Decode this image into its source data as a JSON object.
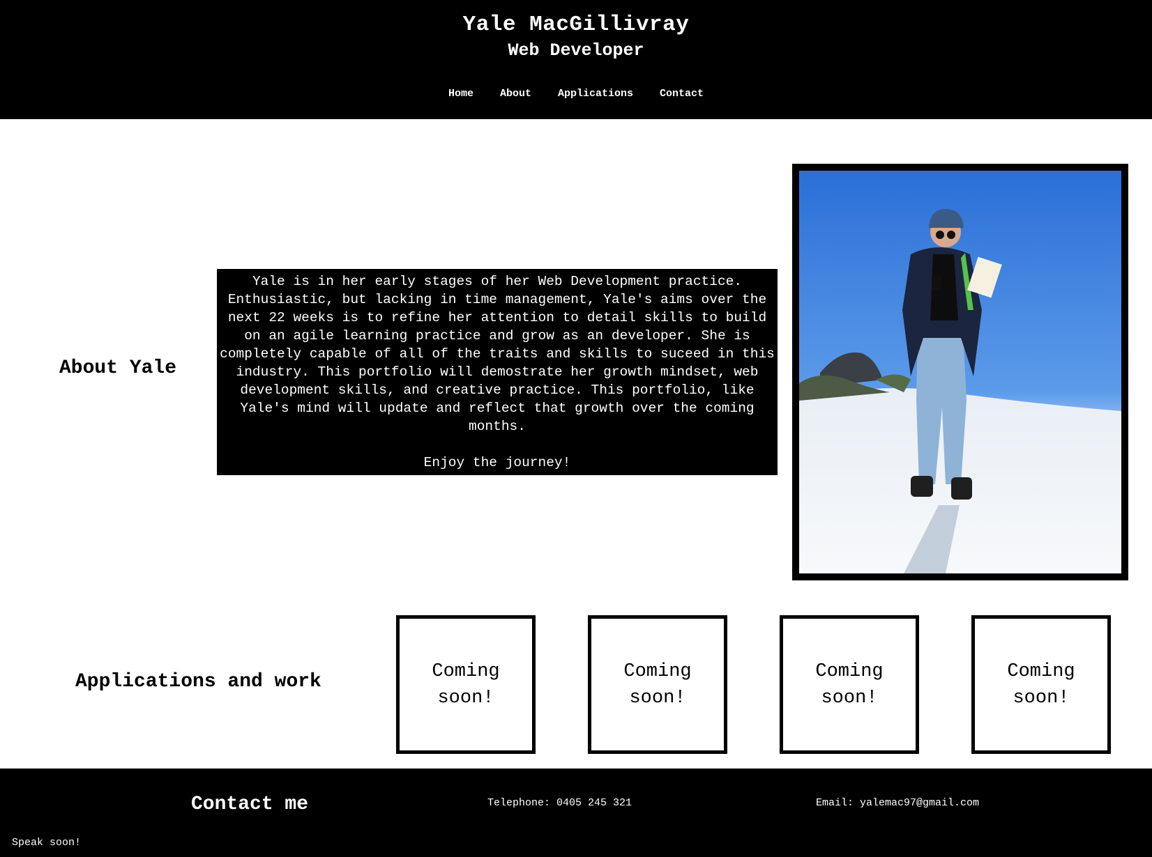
{
  "header": {
    "name": "Yale MacGillivray",
    "role": "Web Developer",
    "nav": [
      {
        "label": "Home"
      },
      {
        "label": "About"
      },
      {
        "label": "Applications"
      },
      {
        "label": "Contact"
      }
    ]
  },
  "about": {
    "heading": "About Yale",
    "body": "Yale is in her early stages of her Web Development practice. Enthusiastic, but lacking in time management, Yale's aims over the next 22 weeks is to refine her attention to detail skills to build on an agile learning practice and grow as an developer. She is completely capable of all of the traits and skills to suceed in this industry. This portfolio will demostrate her growth mindset, web development skills, and creative practice. This portfolio, like Yale's mind will update and reflect that growth over the coming months.",
    "closing": "Enjoy the journey!"
  },
  "applications": {
    "heading": "Applications and work",
    "cards": [
      {
        "label": "Coming soon!"
      },
      {
        "label": "Coming soon!"
      },
      {
        "label": "Coming soon!"
      },
      {
        "label": "Coming soon!"
      }
    ]
  },
  "footer": {
    "heading": "Contact me",
    "phone": "Telephone: 0405 245 321",
    "email": "Email: yalemac97@gmail.com",
    "signoff": "Speak soon!"
  },
  "colors": {
    "header_bg": "#000000",
    "footer_bg": "#000000",
    "page_bg": "#ffffff",
    "text_light": "#ffffff"
  }
}
